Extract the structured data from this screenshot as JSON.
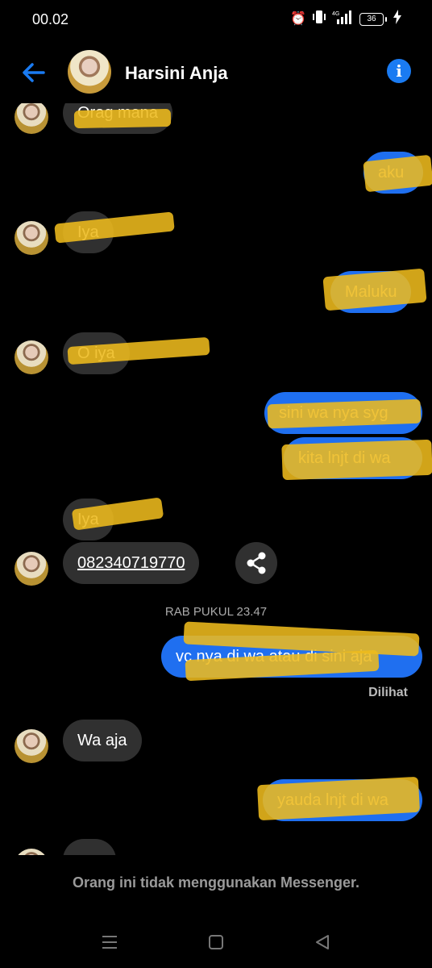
{
  "status_bar": {
    "time": "00.02",
    "battery": "36",
    "network": "4G"
  },
  "header": {
    "contact_name": "Harsini Anja"
  },
  "messages": [
    {
      "dir": "in",
      "text": "Orag mana"
    },
    {
      "dir": "out",
      "text": "aku"
    },
    {
      "dir": "in",
      "text": "Iya"
    },
    {
      "dir": "out",
      "text": "Maluku"
    },
    {
      "dir": "in",
      "text": "O iya"
    },
    {
      "dir": "out",
      "text": "sini wa nya syg"
    },
    {
      "dir": "out",
      "text": "kita lnjt di wa"
    },
    {
      "dir": "in",
      "text": "Iya"
    },
    {
      "dir": "in",
      "text": "082340719770"
    },
    {
      "dir": "out",
      "text": "vc nya di wa atau di sini aja"
    },
    {
      "dir": "in",
      "text": "Wa aja"
    },
    {
      "dir": "out",
      "text": "yauda lnjt di wa"
    }
  ],
  "timestamp": "RAB PUKUL 23.47",
  "seen_label": "Dilihat",
  "footer_note": "Orang ini tidak menggunakan Messenger.",
  "colors": {
    "accent": "#1a7bf2",
    "outgoing_bubble": "#1f6ff0",
    "incoming_bubble": "#303030",
    "redaction": "#eebb1c"
  },
  "icons": [
    "alarm-icon",
    "vibrate-icon",
    "signal-icon",
    "battery-icon",
    "charging-icon",
    "back-arrow-icon",
    "info-icon",
    "share-icon",
    "menu-icon",
    "home-icon",
    "back-icon"
  ]
}
